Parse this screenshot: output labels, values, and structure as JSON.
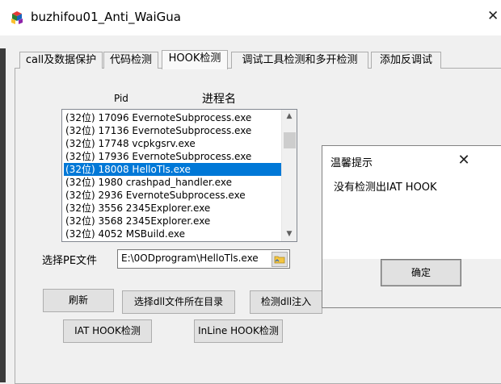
{
  "window": {
    "title": "buzhifou01_Anti_WaiGua",
    "close_glyph": "✕"
  },
  "tabs": [
    {
      "label": "call及数据保护"
    },
    {
      "label": "代码检测"
    },
    {
      "label": "HOOK检测",
      "active": true
    },
    {
      "label": "调试工具检测和多开检测"
    },
    {
      "label": "添加反调试"
    }
  ],
  "process_list": {
    "header_pid": "Pid",
    "header_name": "进程名",
    "rows": [
      "(32位) 17096 EvernoteSubprocess.exe",
      "(32位) 17136 EvernoteSubprocess.exe",
      "(32位) 17748 vcpkgsrv.exe",
      "(32位) 17936 EvernoteSubprocess.exe",
      "(32位) 18008 HelloTls.exe",
      "(32位) 1980 crashpad_handler.exe",
      "(32位) 2936 EvernoteSubprocess.exe",
      "(32位) 3556 2345Explorer.exe",
      "(32位) 3568 2345Explorer.exe",
      "(32位) 4052 MSBuild.exe"
    ],
    "selected_index": 4
  },
  "pe_file": {
    "label": "选择PE文件",
    "value": "E:\\0ODprogram\\HelloTls.exe"
  },
  "buttons": {
    "refresh": "刷新",
    "select_dll_dir": "选择dll文件所在目录",
    "detect_dll_inject": "检测dll注入",
    "iat_hook": "IAT HOOK检测",
    "inline_hook": "InLine HOOK检测"
  },
  "dialog": {
    "title": "温馨提示",
    "message": "没有检测出IAT HOOK",
    "ok": "确定",
    "close_glyph": "✕"
  },
  "colors": {
    "selection": "#0078d7",
    "window_bg": "#f0f0f0"
  }
}
